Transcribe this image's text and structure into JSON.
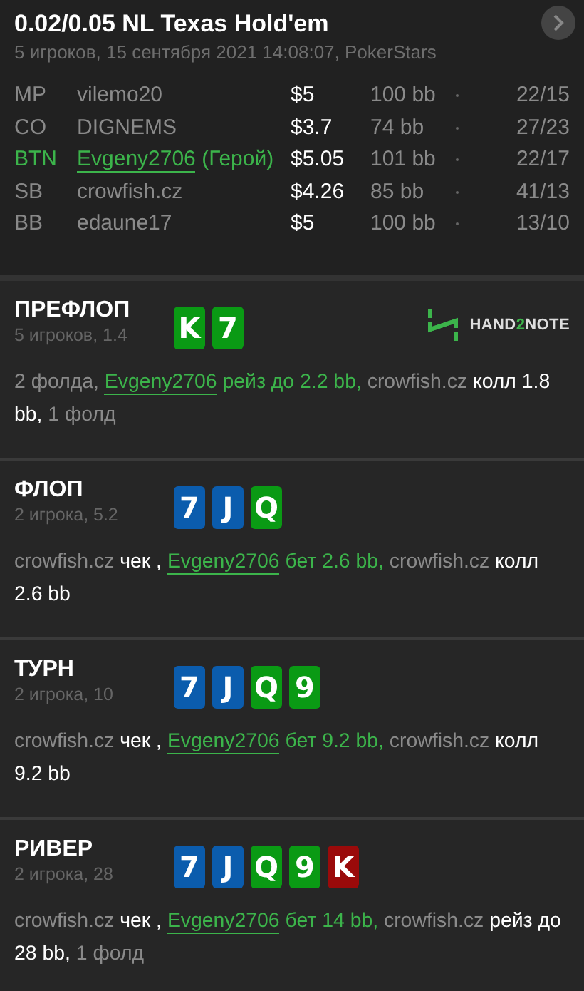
{
  "header": {
    "title": "0.02/0.05 NL Texas Hold'em",
    "subtitle": "5 игроков, 15 сентября 2021 14:08:07, PokerStars"
  },
  "players": [
    {
      "position": "MP",
      "name": "vilemo20",
      "stack": "$5",
      "bb": "100 bb",
      "stats": "22/15",
      "hero": false
    },
    {
      "position": "CO",
      "name": "DIGNEMS",
      "stack": "$3.7",
      "bb": "74 bb",
      "stats": "27/23",
      "hero": false
    },
    {
      "position": "BTN",
      "name": "Evgeny2706",
      "hero_tag": "(Герой)",
      "stack": "$5.05",
      "bb": "101 bb",
      "stats": "22/17",
      "hero": true
    },
    {
      "position": "SB",
      "name": "crowfish.cz",
      "stack": "$4.26",
      "bb": "85 bb",
      "stats": "41/13",
      "hero": false
    },
    {
      "position": "BB",
      "name": "edaune17",
      "stack": "$5",
      "bb": "100 bb",
      "stats": "13/10",
      "hero": false
    }
  ],
  "logo": {
    "prefix": "HAND",
    "accent": "2",
    "suffix": "NOTE"
  },
  "streets": [
    {
      "title": "ПРЕФЛОП",
      "info": "5 игроков, 1.4",
      "show_logo": true,
      "cards": [
        {
          "rank": "K",
          "color": "#0a9a14"
        },
        {
          "rank": "7",
          "color": "#0a9a14"
        }
      ],
      "actions": [
        {
          "text": "2 фолда, ",
          "kind": "muted"
        },
        {
          "text": "Evgeny2706",
          "kind": "hero_name"
        },
        {
          "text": " рейз до 2.2 bb,",
          "kind": "hero"
        },
        {
          "text": " crowfish.cz",
          "kind": "muted"
        },
        {
          "text": " колл 1.8 bb,",
          "kind": "plain"
        },
        {
          "text": " 1 фолд",
          "kind": "muted"
        }
      ]
    },
    {
      "title": "ФЛОП",
      "info": "2 игрока, 5.2",
      "show_logo": false,
      "cards": [
        {
          "rank": "7",
          "color": "#0b5cad"
        },
        {
          "rank": "J",
          "color": "#0b5cad"
        },
        {
          "rank": "Q",
          "color": "#0a9a14"
        }
      ],
      "actions": [
        {
          "text": "crowfish.cz",
          "kind": "muted"
        },
        {
          "text": " чек",
          "kind": "plain"
        },
        {
          "text": " , ",
          "kind": "plain"
        },
        {
          "text": "Evgeny2706",
          "kind": "hero_name"
        },
        {
          "text": " бет 2.6 bb,",
          "kind": "hero"
        },
        {
          "text": " crowfish.cz",
          "kind": "muted"
        },
        {
          "text": " колл 2.6 bb",
          "kind": "plain"
        }
      ]
    },
    {
      "title": "ТУРН",
      "info": "2 игрока, 10",
      "show_logo": false,
      "cards": [
        {
          "rank": "7",
          "color": "#0b5cad"
        },
        {
          "rank": "J",
          "color": "#0b5cad"
        },
        {
          "rank": "Q",
          "color": "#0a9a14"
        },
        {
          "rank": "9",
          "color": "#0a9a14"
        }
      ],
      "actions": [
        {
          "text": "crowfish.cz",
          "kind": "muted"
        },
        {
          "text": " чек",
          "kind": "plain"
        },
        {
          "text": " , ",
          "kind": "plain"
        },
        {
          "text": "Evgeny2706",
          "kind": "hero_name"
        },
        {
          "text": " бет 9.2 bb,",
          "kind": "hero"
        },
        {
          "text": " crowfish.cz",
          "kind": "muted"
        },
        {
          "text": " колл 9.2 bb",
          "kind": "plain"
        }
      ]
    },
    {
      "title": "РИВЕР",
      "info": "2 игрока, 28",
      "show_logo": false,
      "cards": [
        {
          "rank": "7",
          "color": "#0b5cad"
        },
        {
          "rank": "J",
          "color": "#0b5cad"
        },
        {
          "rank": "Q",
          "color": "#0a9a14"
        },
        {
          "rank": "9",
          "color": "#0a9a14"
        },
        {
          "rank": "K",
          "color": "#9a0a0a"
        }
      ],
      "actions": [
        {
          "text": "crowfish.cz",
          "kind": "muted"
        },
        {
          "text": " чек",
          "kind": "plain"
        },
        {
          "text": " , ",
          "kind": "plain"
        },
        {
          "text": "Evgeny2706",
          "kind": "hero_name"
        },
        {
          "text": " бет 14 bb,",
          "kind": "hero"
        },
        {
          "text": " crowfish.cz",
          "kind": "muted"
        },
        {
          "text": " рейз до 28 bb,",
          "kind": "plain"
        },
        {
          "text": " 1 фолд",
          "kind": "muted"
        }
      ]
    }
  ]
}
